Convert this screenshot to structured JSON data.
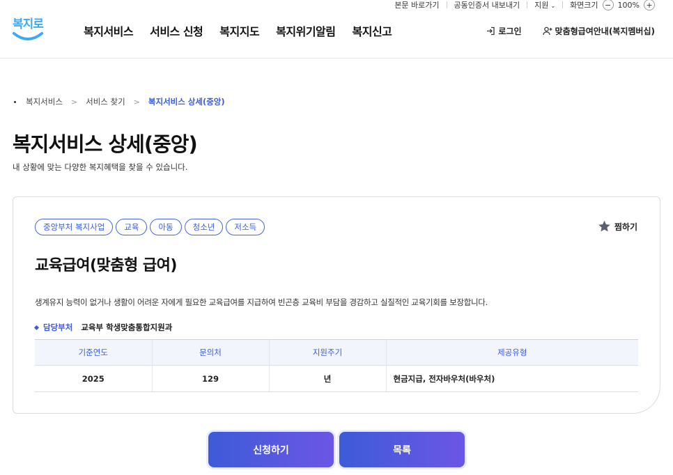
{
  "util": {
    "skip_link": "본문 바로가기",
    "cert_export": "공동인증서 내보내기",
    "support": "지원",
    "screen_size": "화면크기",
    "zoom_out": "−",
    "zoom_level": "100%",
    "zoom_in": "+"
  },
  "header": {
    "logo_text": "복지로",
    "nav": [
      "복지서비스",
      "서비스 신청",
      "복지지도",
      "복지위기알림",
      "복지신고"
    ],
    "login": "로그인",
    "membership": "맞춤형급여안내(복지멤버십)"
  },
  "breadcrumb": [
    "복지서비스",
    "서비스 찾기",
    "복지서비스 상세(중앙)"
  ],
  "page": {
    "title": "복지서비스 상세(중앙)",
    "subtitle": "내 상황에 맞는 다양한 복지혜택을 찾을 수 있습니다."
  },
  "service": {
    "tags": [
      "중앙부처 복지사업",
      "교육",
      "아동",
      "청소년",
      "저소득"
    ],
    "favorite": "찜하기",
    "title": "교육급여(맞춤형 급여)",
    "description": "생계유지 능력이 없거나 생활이 어려운 자에게 필요한 교육급여를 지급하여 빈곤층 교육비 부담을 경감하고 실질적인 교육기회를 보장합니다.",
    "dept_label": "담당부처",
    "dept_value": "교육부 학생맞춤통합지원과",
    "table": {
      "headers": [
        "기준연도",
        "문의처",
        "지원주기",
        "제공유형"
      ],
      "row": [
        "2025",
        "129",
        "년",
        "현금지급, 전자바우처(바우처)"
      ]
    }
  },
  "actions": {
    "apply": "신청하기",
    "list": "목록"
  },
  "colors": {
    "accent": "#3b5bdb",
    "button_gradient_start": "#3d5bd9",
    "button_gradient_end": "#6c56e6",
    "table_header_bg": "#f2f5fb"
  }
}
